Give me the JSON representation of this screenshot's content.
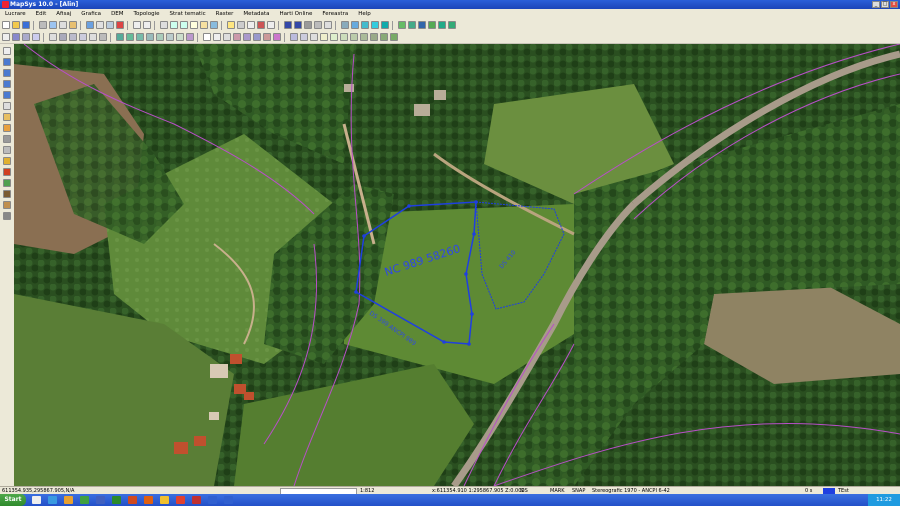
{
  "window": {
    "title": "MapSys 10.0 - [Alin]"
  },
  "menu": [
    "Lucrare",
    "Edit",
    "Afisaj",
    "Grafica",
    "DEM",
    "Topologie",
    "Strat tematic",
    "Raster",
    "Metadata",
    "Harti Online",
    "Fereastra",
    "Help"
  ],
  "map": {
    "parcel_label": "NC 989 58260",
    "road_label_1": "DS 399 ANCPI 989",
    "road_label_2": "DS 410",
    "colors": {
      "parcel": "#1f3fe0",
      "boundary": "#b84fc8"
    }
  },
  "status": {
    "coords": "611354.935,295867.905,N/A",
    "scale": "1:812",
    "cursor": "x:611354.910 1:295867.905 Z:0.000",
    "modes": [
      "SIS",
      "MARK",
      "SNAP"
    ],
    "projection": "Stereografic 1970 - ANCPI 6-42",
    "zoom": "0 s",
    "extra": "TEst"
  },
  "taskbar": {
    "start_label": "Start",
    "time": "11:22"
  }
}
